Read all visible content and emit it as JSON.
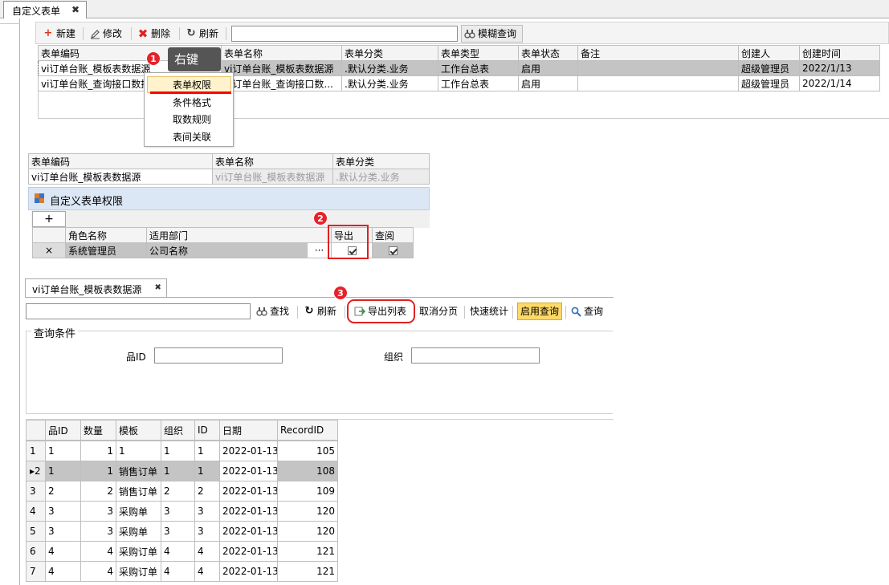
{
  "top_tab": {
    "label": "自定义表单",
    "close": "✖"
  },
  "toolbar": {
    "new_label": "新建",
    "edit_label": "修改",
    "delete_label": "删除",
    "refresh_label": "刷新",
    "search_value": "",
    "fuzzy_label": "模糊查询"
  },
  "form_grid": {
    "columns": [
      "表单编码",
      "表单名称",
      "表单分类",
      "表单类型",
      "表单状态",
      "备注",
      "创建人",
      "创建时间"
    ],
    "rows": [
      {
        "code": "vi订单台账_模板表数据源",
        "name": "vi订单台账_模板表数据源",
        "category": ".默认分类.业务",
        "type": "工作台总表",
        "status": "启用",
        "remark": "",
        "creator": "超级管理员",
        "created": "2022/1/13"
      },
      {
        "code": "vi订单台账_查询接口数据源",
        "name": "vi订单台账_查询接口数...",
        "category": ".默认分类.业务",
        "type": "工作台总表",
        "status": "启用",
        "remark": "",
        "creator": "超级管理员",
        "created": "2022/1/14"
      }
    ]
  },
  "context_menu": {
    "tooltip": "右键",
    "items": [
      "表单权限",
      "条件格式",
      "取数规则",
      "表间关联"
    ]
  },
  "badges": {
    "b1": "1",
    "b2": "2",
    "b3": "3"
  },
  "perm_info": {
    "columns": [
      "表单编码",
      "表单名称",
      "表单分类"
    ],
    "row": {
      "code": "vi订单台账_模板表数据源",
      "name": "vi订单台账_模板表数据源",
      "category": ".默认分类.业务"
    }
  },
  "perm_panel": {
    "title": "自定义表单权限",
    "add": "+",
    "columns": [
      "角色名称",
      "适用部门",
      "导出",
      "查阅"
    ],
    "row": {
      "delete": "×",
      "role": "系统管理员",
      "dept": "公司名称",
      "picker": "···",
      "export_checked": true,
      "view_checked": true
    }
  },
  "query_tab": {
    "label": "vi订单台账_模板表数据源",
    "close": "✖"
  },
  "query_toolbar": {
    "search_value": "",
    "find_label": "查找",
    "refresh_label": "刷新",
    "export_label": "导出列表",
    "cancel_paging_label": "取消分页",
    "quick_stats_label": "快速统计",
    "enable_query_label": "启用查询",
    "query_label": "查询"
  },
  "conditions": {
    "title": "查询条件",
    "field1_label": "品ID",
    "field1_value": "",
    "field2_label": "组织",
    "field2_value": ""
  },
  "result_grid": {
    "columns": [
      "品ID",
      "数量",
      "模板",
      "组织",
      "ID",
      "日期",
      "RecordID"
    ],
    "rows": [
      {
        "idx": "1",
        "pid": "1",
        "qty": "1",
        "tpl": "1",
        "org": "1",
        "id": "1",
        "date": "2022-01-13",
        "rid": "105"
      },
      {
        "idx": "▸2",
        "pid": "1",
        "qty": "1",
        "tpl": "销售订单",
        "org": "1",
        "id": "1",
        "date": "2022-01-13",
        "rid": "108"
      },
      {
        "idx": "3",
        "pid": "2",
        "qty": "2",
        "tpl": "销售订单",
        "org": "2",
        "id": "2",
        "date": "2022-01-13",
        "rid": "109"
      },
      {
        "idx": "4",
        "pid": "3",
        "qty": "3",
        "tpl": "采购单",
        "org": "3",
        "id": "3",
        "date": "2022-01-13",
        "rid": "120"
      },
      {
        "idx": "5",
        "pid": "3",
        "qty": "3",
        "tpl": "采购单",
        "org": "3",
        "id": "3",
        "date": "2022-01-13",
        "rid": "120"
      },
      {
        "idx": "6",
        "pid": "4",
        "qty": "4",
        "tpl": "采购订单",
        "org": "4",
        "id": "4",
        "date": "2022-01-13",
        "rid": "121"
      },
      {
        "idx": "7",
        "pid": "4",
        "qty": "4",
        "tpl": "采购订单",
        "org": "4",
        "id": "4",
        "date": "2022-01-13",
        "rid": "121"
      }
    ]
  },
  "colors": {
    "accent_red": "#e02020",
    "highlight_yellow": "#fff2cc",
    "selected_row": "#c4c4c4",
    "panel_blue": "#dce7f6"
  }
}
